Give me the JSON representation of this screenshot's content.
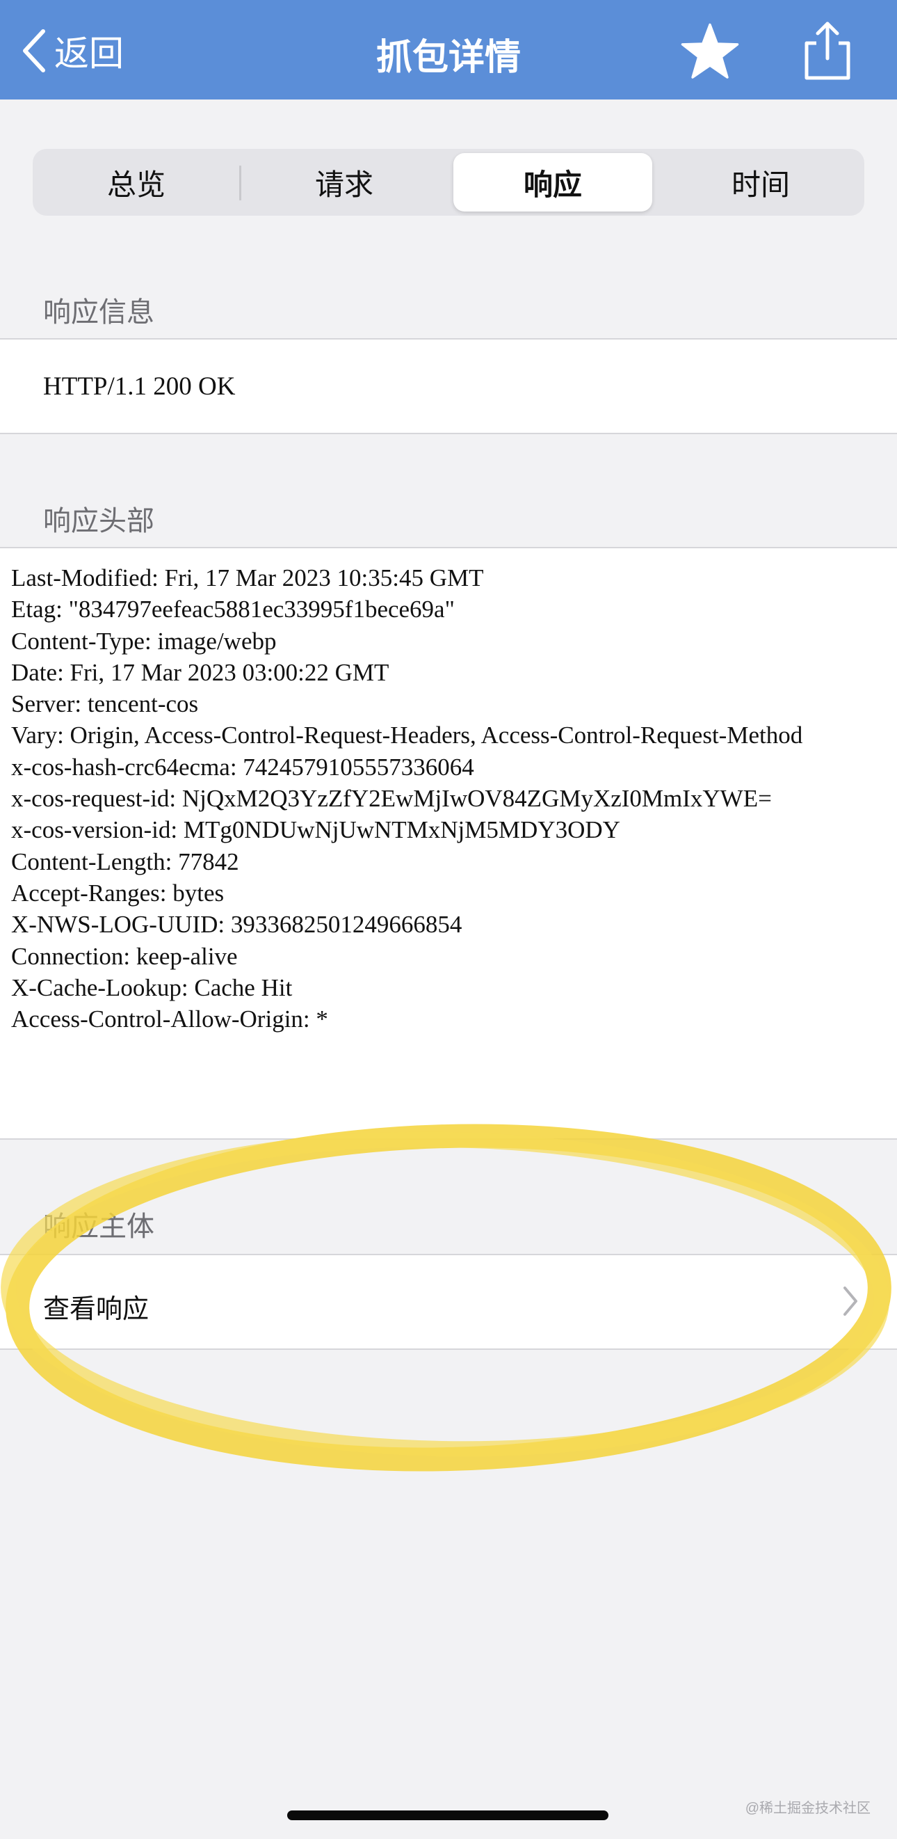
{
  "navbar": {
    "back_label": "返回",
    "title": "抓包详情",
    "icons": {
      "back": "chevron-left-icon",
      "favorite": "star-icon",
      "share": "share-icon"
    },
    "accent_color": "#5b8ed8"
  },
  "tabs": [
    {
      "label": "总览",
      "active": false
    },
    {
      "label": "请求",
      "active": false
    },
    {
      "label": "响应",
      "active": true
    },
    {
      "label": "时间",
      "active": false
    }
  ],
  "response_info": {
    "header": "响应信息",
    "status_line": "HTTP/1.1 200 OK"
  },
  "response_headers": {
    "header": "响应头部",
    "lines": [
      "Last-Modified: Fri, 17 Mar 2023 10:35:45 GMT",
      "Etag: \"834797eefeac5881ec33995f1bece69a\"",
      "Content-Type: image/webp",
      "Date: Fri, 17 Mar 2023 03:00:22 GMT",
      "Server: tencent-cos",
      "Vary: Origin, Access-Control-Request-Headers, Access-Control-Request-Method",
      "x-cos-hash-crc64ecma: 7424579105557336064",
      "x-cos-request-id: NjQxM2Q3YzZfY2EwMjIwOV84ZGMyXzI0MmIxYWE=",
      "x-cos-version-id: MTg0NDUwNjUwNTMxNjM5MDY3ODY",
      "Content-Length: 77842",
      "Accept-Ranges: bytes",
      "X-NWS-LOG-UUID: 3933682501249666854",
      "Connection: keep-alive",
      "X-Cache-Lookup: Cache Hit",
      "Access-Control-Allow-Origin: *"
    ]
  },
  "response_body": {
    "header": "响应主体",
    "view_label": "查看响应",
    "icon": "chevron-right-icon",
    "highlight_color": "#f5d43a"
  },
  "watermark": "@稀土掘金技术社区"
}
